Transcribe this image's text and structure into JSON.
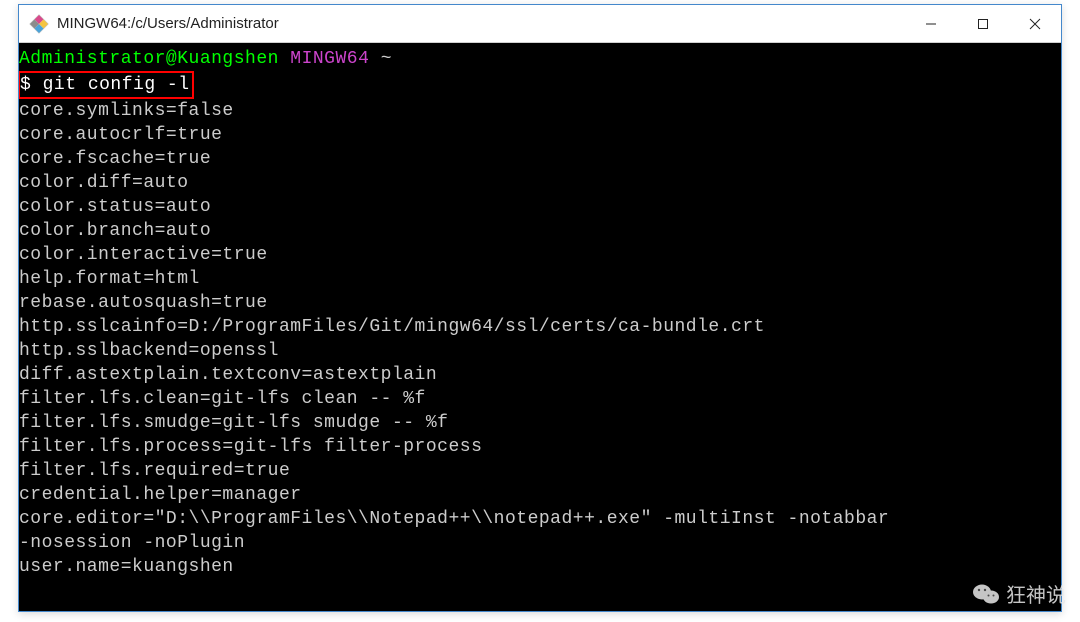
{
  "window": {
    "title": "MINGW64:/c/Users/Administrator"
  },
  "prompt": {
    "user_host": "Administrator@Kuangshen",
    "env": "MINGW64",
    "path": "~"
  },
  "command": {
    "prefix": "$ ",
    "text": "git config -l"
  },
  "output": [
    "core.symlinks=false",
    "core.autocrlf=true",
    "core.fscache=true",
    "color.diff=auto",
    "color.status=auto",
    "color.branch=auto",
    "color.interactive=true",
    "help.format=html",
    "rebase.autosquash=true",
    "http.sslcainfo=D:/ProgramFiles/Git/mingw64/ssl/certs/ca-bundle.crt",
    "http.sslbackend=openssl",
    "diff.astextplain.textconv=astextplain",
    "filter.lfs.clean=git-lfs clean -- %f",
    "filter.lfs.smudge=git-lfs smudge -- %f",
    "filter.lfs.process=git-lfs filter-process",
    "filter.lfs.required=true",
    "credential.helper=manager",
    "core.editor=\"D:\\\\ProgramFiles\\\\Notepad++\\\\notepad++.exe\" -multiInst -notabbar ",
    "-nosession -noPlugin",
    "user.name=kuangshen"
  ],
  "watermark": {
    "text": "狂神说"
  }
}
